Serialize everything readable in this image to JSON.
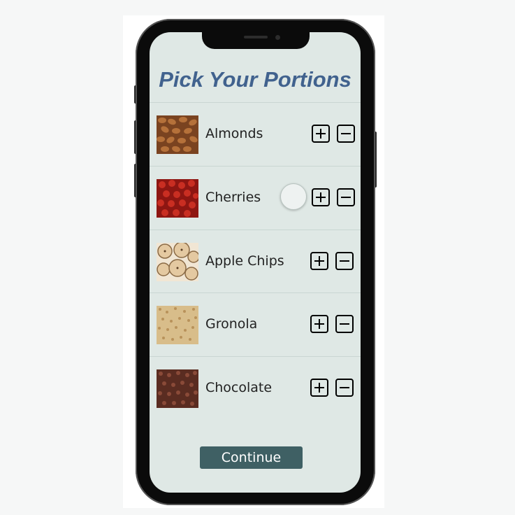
{
  "title": "Pick Your Portions",
  "items": [
    {
      "label": "Almonds",
      "icon": "almonds-image",
      "color": "#a8652e"
    },
    {
      "label": "Cherries",
      "icon": "cherries-image",
      "color": "#b9241c"
    },
    {
      "label": "Apple Chips",
      "icon": "apple-chips-image",
      "color": "#e2cba6"
    },
    {
      "label": "Gronola",
      "icon": "granola-image",
      "color": "#d9bf8c"
    },
    {
      "label": "Chocolate",
      "icon": "chocolate-image",
      "color": "#6b3527"
    }
  ],
  "continue_label": "Continue",
  "colors": {
    "title": "#41628e",
    "screen_bg": "#dfe8e5",
    "continue_bg": "#3f6064"
  }
}
